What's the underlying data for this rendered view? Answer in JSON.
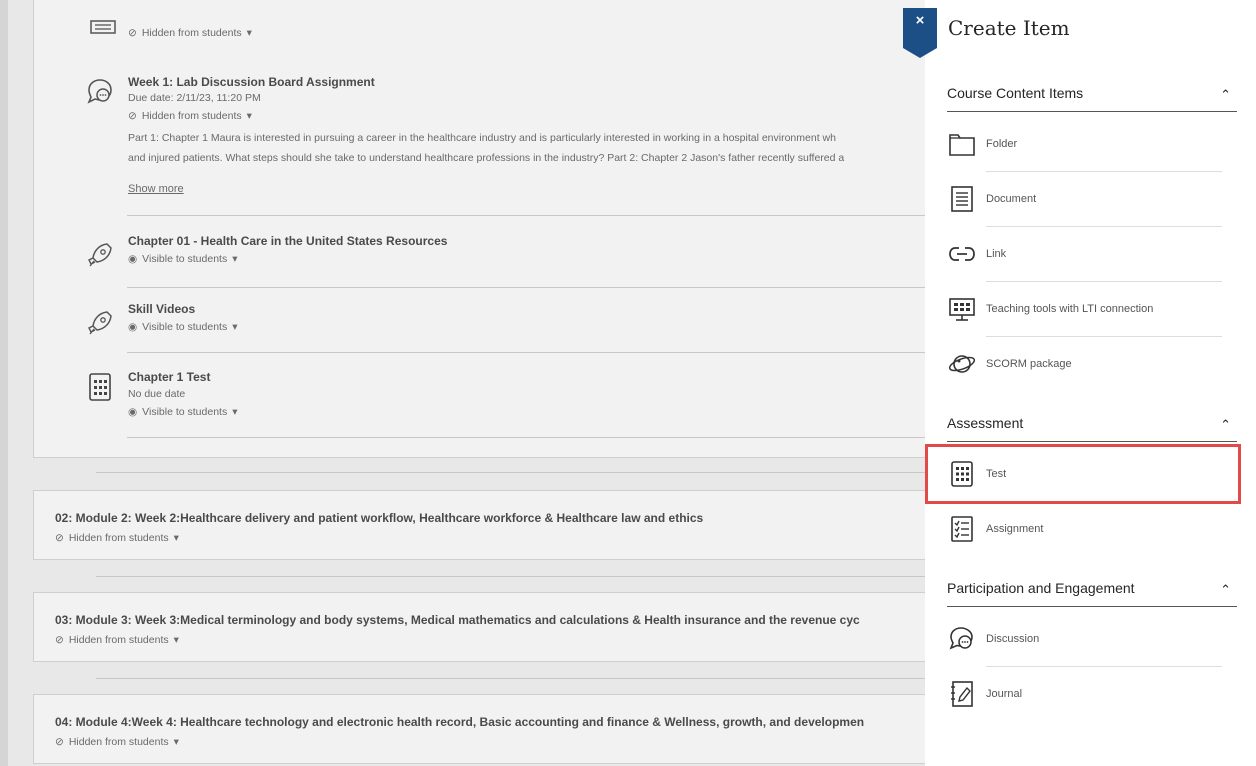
{
  "course": {
    "top_item": {
      "visibility": "Hidden from students"
    },
    "discussion": {
      "title": "Week 1: Lab Discussion Board Assignment",
      "due": "Due date: 2/11/23, 11:20 PM",
      "visibility": "Hidden from students",
      "desc_line1": "Part 1: Chapter 1 Maura is interested in pursuing a career in the healthcare industry and is particularly interested in working in a hospital environment wh",
      "desc_line2": "and injured patients. What steps should she take to understand healthcare professions in the industry? Part 2: Chapter 2 Jason's father recently suffered a",
      "show_more": "Show more"
    },
    "resources": {
      "title": "Chapter 01 - Health Care in the United States Resources",
      "visibility": "Visible to students"
    },
    "videos": {
      "title": "Skill Videos",
      "visibility": "Visible to students"
    },
    "test": {
      "title": "Chapter 1 Test",
      "due": "No due date",
      "visibility": "Visible to students"
    },
    "modules": [
      {
        "title": "02: Module 2: Week 2:Healthcare delivery and patient workflow, Healthcare workforce & Healthcare law and ethics",
        "visibility": "Hidden from students"
      },
      {
        "title": "03: Module 3: Week 3:Medical terminology and body systems, Medical mathematics and calculations & Health insurance and the revenue cyc",
        "visibility": "Hidden from students"
      },
      {
        "title": "04: Module 4:Week 4: Healthcare technology and electronic health record, Basic accounting and finance & Wellness, growth, and developmen",
        "visibility": "Hidden from students"
      }
    ],
    "dropdown_caret": "▾"
  },
  "panel": {
    "close_label": "×",
    "title": "Create Item",
    "collapse_chevron": "⌃",
    "sections": [
      {
        "title": "Course Content Items",
        "items": [
          {
            "label": "Folder",
            "icon": "folder-icon"
          },
          {
            "label": "Document",
            "icon": "document-icon"
          },
          {
            "label": "Link",
            "icon": "link-icon"
          },
          {
            "label": "Teaching tools with LTI connection",
            "icon": "lti-icon"
          },
          {
            "label": "SCORM package",
            "icon": "scorm-icon"
          }
        ]
      },
      {
        "title": "Assessment",
        "items": [
          {
            "label": "Test",
            "icon": "test-icon",
            "highlighted": true
          },
          {
            "label": "Assignment",
            "icon": "assignment-icon"
          }
        ]
      },
      {
        "title": "Participation and Engagement",
        "items": [
          {
            "label": "Discussion",
            "icon": "discussion-icon"
          },
          {
            "label": "Journal",
            "icon": "journal-icon"
          }
        ]
      }
    ],
    "highlight_color": "#e34949",
    "accent_color": "#1b4f85"
  }
}
